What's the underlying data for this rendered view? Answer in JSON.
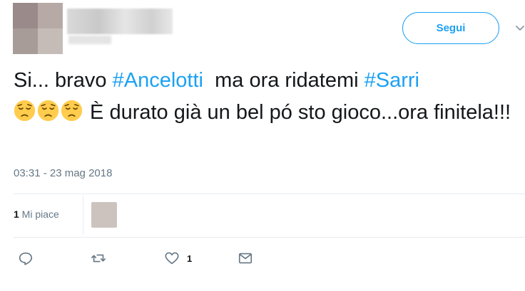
{
  "header": {
    "follow_label": "Segui"
  },
  "tweet": {
    "text_part1": "Si... bravo ",
    "hashtag1": "#Ancelotti",
    "text_part2": "  ma ora ridatemi ",
    "hashtag2": "#Sarri",
    "text_part3": " È durato già un bel pó sto gioco...ora finitela!!!",
    "emoji": [
      "pensive-face-emoji",
      "pensive-face-emoji",
      "pensive-face-emoji"
    ],
    "timestamp": "03:31 - 23 mag 2018"
  },
  "stats": {
    "likes_number": "1",
    "likes_label": " Mi piace"
  },
  "actions": {
    "reply_icon": "reply-icon",
    "retweet_icon": "retweet-icon",
    "like_icon": "heart-icon",
    "like_count": "1",
    "dm_icon": "envelope-icon"
  },
  "colors": {
    "accent": "#1da1f2",
    "muted": "#657786",
    "text": "#14171a",
    "divider": "#e6ecf0"
  }
}
